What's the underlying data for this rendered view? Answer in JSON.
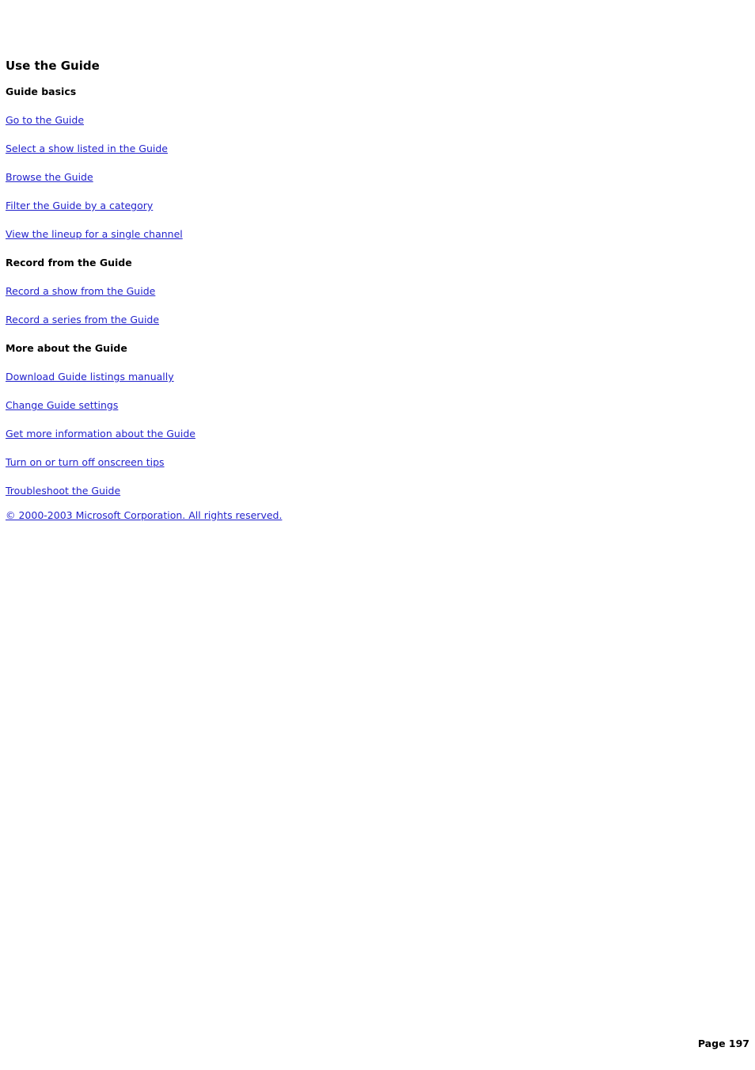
{
  "document": {
    "title": "Use the Guide",
    "sections": [
      {
        "heading": "Guide basics",
        "links": [
          "Go to the Guide",
          "Select a show listed in the Guide",
          "Browse the Guide",
          "Filter the Guide by a category",
          "View the lineup for a single channel"
        ]
      },
      {
        "heading": "Record from the Guide",
        "links": [
          "Record a show from the Guide",
          "Record a series from the Guide"
        ]
      },
      {
        "heading": "More about the Guide",
        "links": [
          "Download Guide listings manually",
          "Change Guide settings",
          "Get more information about the Guide",
          "Turn on or turn off onscreen tips",
          "Troubleshoot the Guide"
        ]
      }
    ],
    "copyright": "© 2000-2003 Microsoft Corporation. All rights reserved.",
    "page_footer": "Page 197",
    "colors": {
      "link": "#2222CC",
      "text": "#000000",
      "background": "#ffffff"
    }
  }
}
